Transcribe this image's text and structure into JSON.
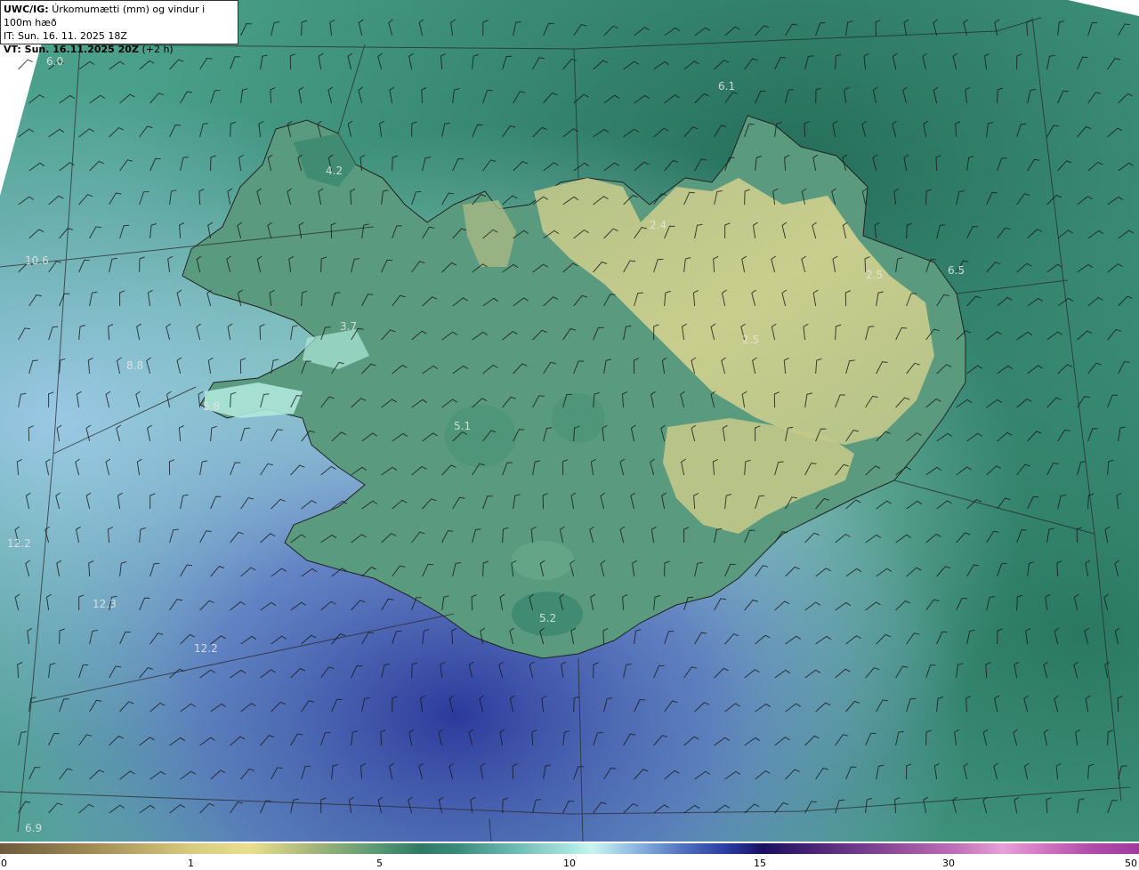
{
  "header": {
    "title_bold": "UWC/IG:",
    "title_rest": "Úrkomumætti (mm) og vindur i 100m hæð",
    "it_line": "IT: Sun. 16. 11. 2025 18Z",
    "vt_bold": "VT: Sun. 16.11.2025 20Z",
    "vt_rest": "(+2 h)"
  },
  "value_labels": [
    "6.0",
    "6.1",
    "4.2",
    "2.4",
    "2.5",
    "6.5",
    "2.5",
    "10.6",
    "3.7",
    "8.8",
    "5.8",
    "5.1",
    "12.2",
    "12.3",
    "12.2",
    "5.2",
    "6.9"
  ],
  "colorbar": {
    "ticks": [
      "0",
      "1",
      "5",
      "10",
      "15",
      "30",
      "50"
    ]
  },
  "colors": {
    "land_high": "#c6c98a",
    "land_mid": "#6aa080",
    "ocean_deep": "#2f6e5c",
    "ocean_light": "#b8ece6",
    "precip_heavy": "#3040a0"
  }
}
